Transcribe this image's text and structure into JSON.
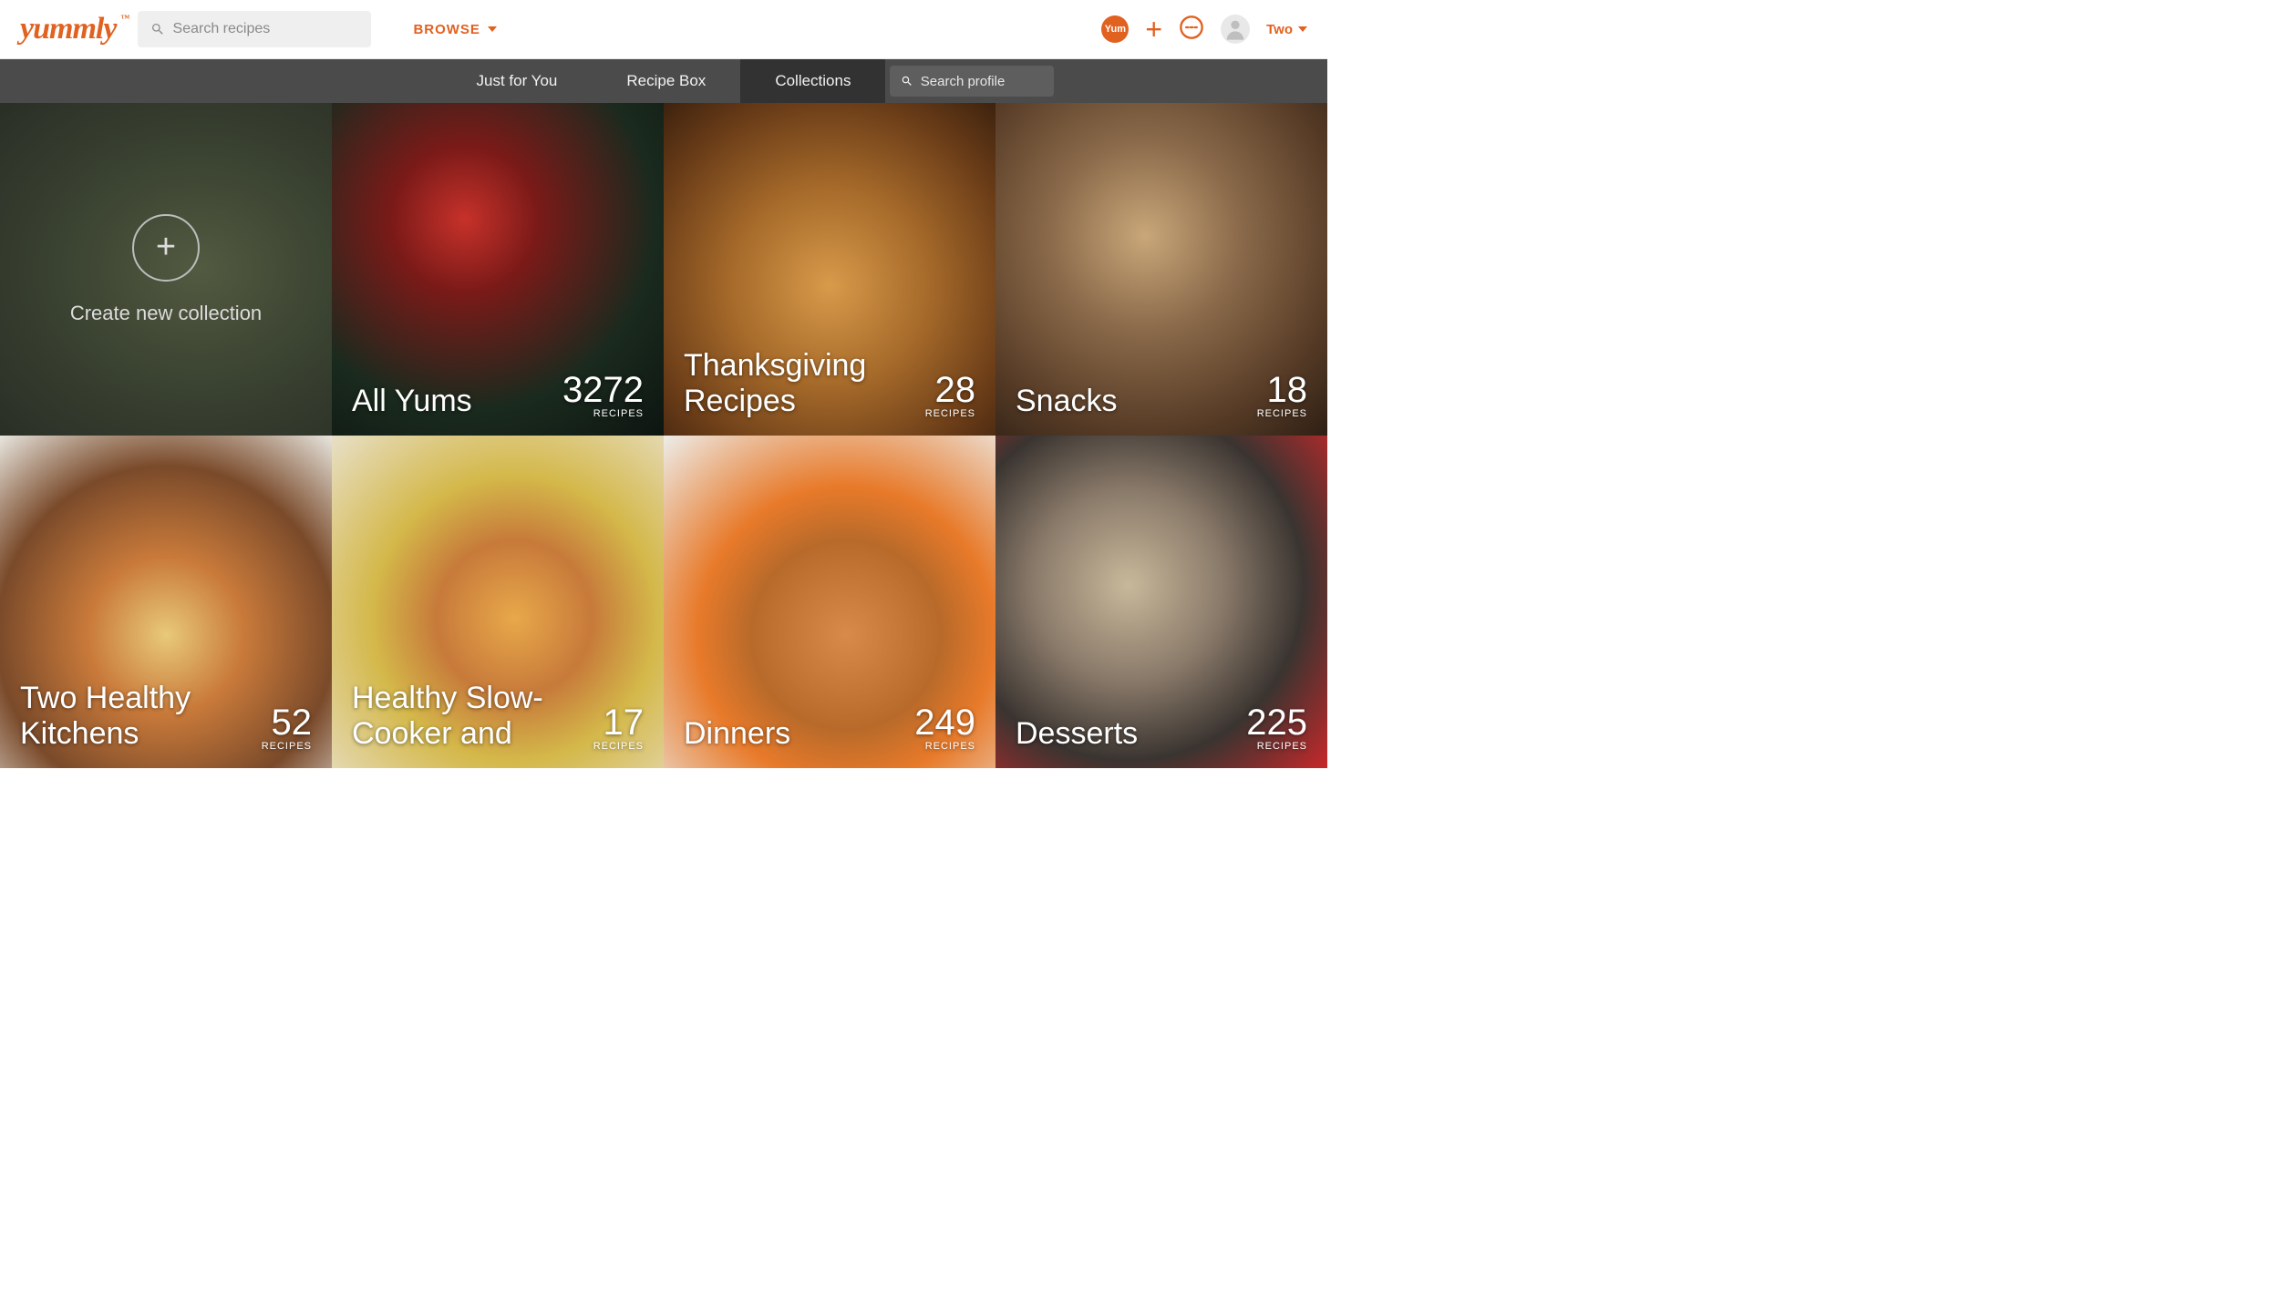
{
  "header": {
    "logo_text": "yummly",
    "search_placeholder": "Search recipes",
    "browse_label": "BROWSE",
    "yum_badge": "Yum",
    "user_name": "Two"
  },
  "subnav": {
    "tabs": [
      {
        "label": "Just for You",
        "active": false
      },
      {
        "label": "Recipe Box",
        "active": false
      },
      {
        "label": "Collections",
        "active": true
      }
    ],
    "profile_search_placeholder": "Search profile"
  },
  "create": {
    "label": "Create new collection"
  },
  "collections": [
    {
      "title": "All Yums",
      "count": "3272",
      "recipes_label": "RECIPES",
      "bg": "bg-allyums"
    },
    {
      "title": "Thanksgiving Recipes",
      "count": "28",
      "recipes_label": "RECIPES",
      "bg": "bg-thanksgiving"
    },
    {
      "title": "Snacks",
      "count": "18",
      "recipes_label": "RECIPES",
      "bg": "bg-snacks"
    },
    {
      "title": "Two Healthy Kitchens",
      "count": "52",
      "recipes_label": "RECIPES",
      "bg": "bg-twohealthy"
    },
    {
      "title": "Healthy Slow-Cooker and",
      "count": "17",
      "recipes_label": "RECIPES",
      "bg": "bg-slowcooker"
    },
    {
      "title": "Dinners",
      "count": "249",
      "recipes_label": "RECIPES",
      "bg": "bg-dinners"
    },
    {
      "title": "Desserts",
      "count": "225",
      "recipes_label": "RECIPES",
      "bg": "bg-desserts"
    }
  ]
}
